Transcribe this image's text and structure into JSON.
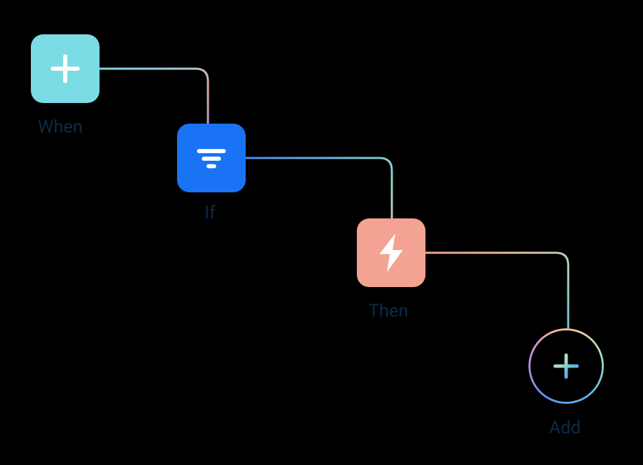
{
  "nodes": {
    "when": {
      "label": "When",
      "icon": "plus-icon",
      "color": "#7cdce5"
    },
    "if": {
      "label": "If",
      "icon": "filter-icon",
      "color": "#1a73f5"
    },
    "then": {
      "label": "Then",
      "icon": "lightning-icon",
      "color": "#f3a392"
    },
    "add": {
      "label": "Add",
      "icon": "plus-gradient-icon"
    }
  }
}
